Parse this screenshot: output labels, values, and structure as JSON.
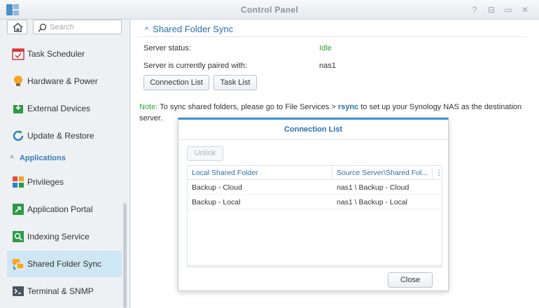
{
  "window": {
    "title": "Control Panel"
  },
  "sidebar": {
    "search_placeholder": "Search",
    "section_label": "Applications",
    "items": [
      {
        "label": "Task Scheduler",
        "icon": "calendar-icon"
      },
      {
        "label": "Hardware & Power",
        "icon": "lightbulb-icon"
      },
      {
        "label": "External Devices",
        "icon": "external-device-icon"
      },
      {
        "label": "Update & Restore",
        "icon": "update-icon"
      },
      {
        "label": "Privileges",
        "icon": "privileges-icon"
      },
      {
        "label": "Application Portal",
        "icon": "portal-icon"
      },
      {
        "label": "Indexing Service",
        "icon": "indexing-icon"
      },
      {
        "label": "Shared Folder Sync",
        "icon": "shared-folder-sync-icon",
        "active": true
      },
      {
        "label": "Terminal & SNMP",
        "icon": "terminal-icon"
      }
    ]
  },
  "main": {
    "heading": "Shared Folder Sync",
    "server_status_label": "Server status:",
    "server_status_value": "Idle",
    "paired_label": "Server is currently paired with:",
    "paired_value": "nas1",
    "buttons": {
      "connection_list": "Connection List",
      "task_list": "Task List"
    },
    "note": {
      "prefix": "Note:",
      "text1": " To sync shared folders, please go to File Services > ",
      "rsync": "rsync",
      "text2": " to set up your Synology NAS as the destination server."
    }
  },
  "dialog": {
    "title": "Connection List",
    "unlink_label": "Unlink",
    "columns": [
      "Local Shared Folder",
      "Source Server\\Shared Fol..."
    ],
    "rows": [
      [
        "Backup - Cloud",
        "nas1 \\ Backup - Cloud"
      ],
      [
        "Backup - Local",
        "nas1 \\ Backup - Local"
      ]
    ],
    "close_label": "Close"
  },
  "colors": {
    "accent": "#2a6fb0",
    "status_idle": "#2fa23a",
    "selection": "#cfe6f5"
  }
}
